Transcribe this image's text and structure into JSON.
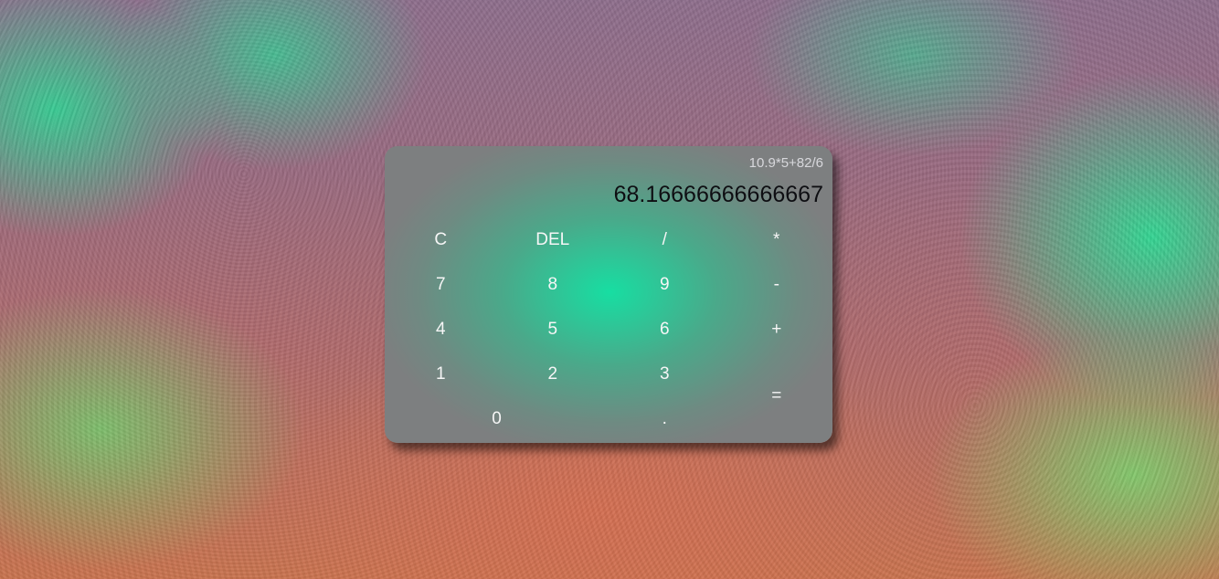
{
  "display": {
    "previous": "10.9*5+82/6",
    "current": "68.16666666666667"
  },
  "keys": {
    "clear": "C",
    "delete": "DEL",
    "divide": "/",
    "multiply": "*",
    "seven": "7",
    "eight": "8",
    "nine": "9",
    "minus": "-",
    "four": "4",
    "five": "5",
    "six": "6",
    "plus": "+",
    "one": "1",
    "two": "2",
    "three": "3",
    "equals": "=",
    "zero": "0",
    "decimal": "."
  },
  "colors": {
    "accent": "#17dea2",
    "card_edge": "#7d7f80",
    "result_text": "#0e0e12",
    "key_text": "#f6f6f6"
  }
}
